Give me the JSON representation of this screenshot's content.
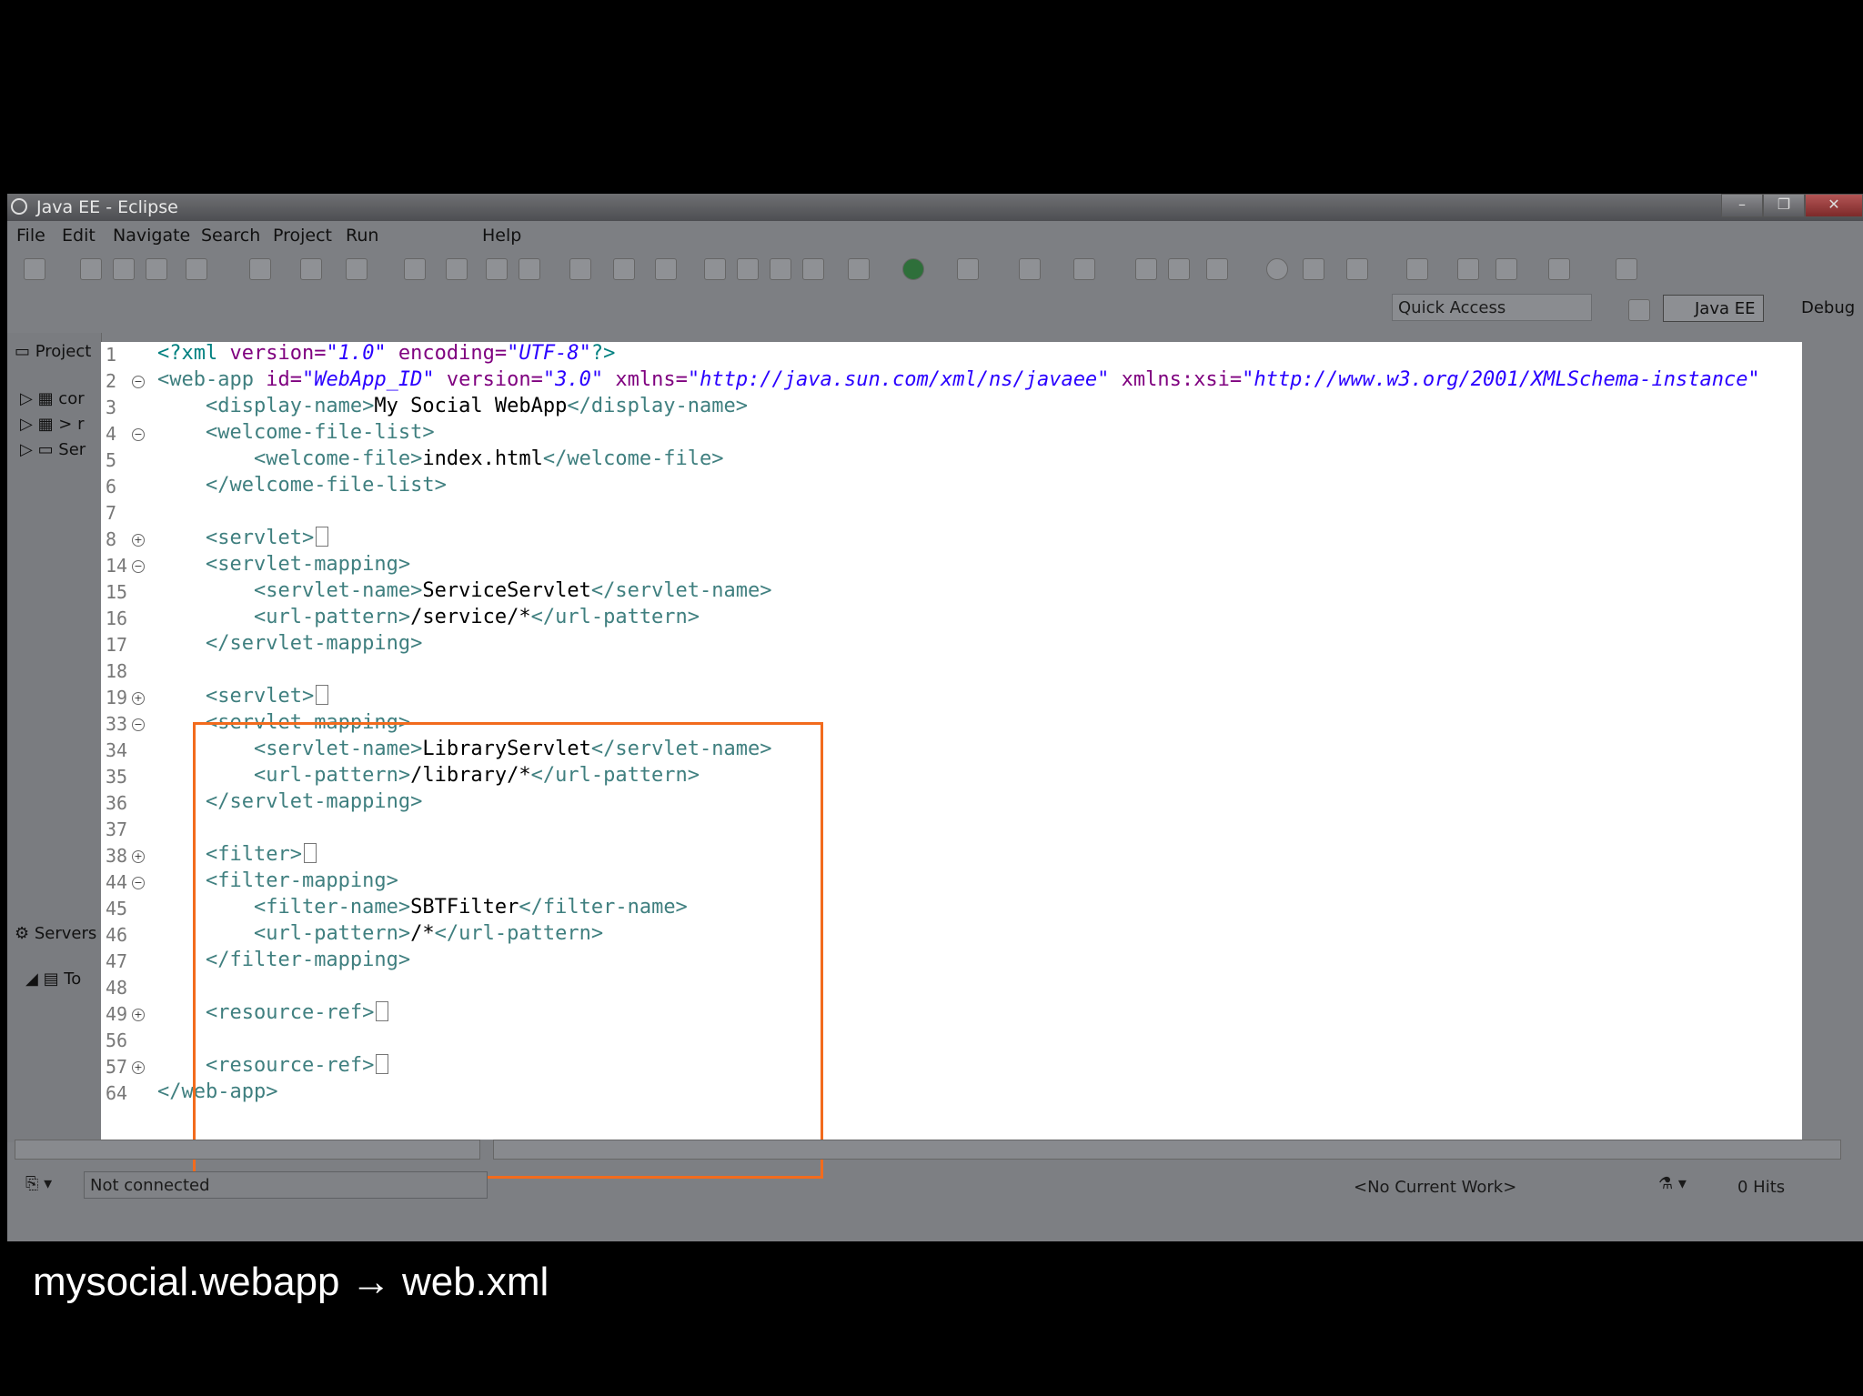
{
  "window": {
    "title": "Java EE - Eclipse"
  },
  "menu": [
    "File",
    "Edit",
    "Navigate",
    "Search",
    "Project",
    "Run",
    "Help"
  ],
  "toolbar": {
    "quick_access_placeholder": "Quick Access"
  },
  "perspectives": {
    "java_ee": "Java EE",
    "debug": "Debug"
  },
  "left_pane": {
    "tab_label": "Project",
    "items": [
      "cor",
      "> r",
      "Ser"
    ]
  },
  "servers_pane": {
    "tab_label": "Servers",
    "items": [
      "To"
    ]
  },
  "editor": {
    "lines": [
      {
        "n": "1",
        "fold": ""
      },
      {
        "n": "2",
        "fold": "minus"
      },
      {
        "n": "3",
        "fold": ""
      },
      {
        "n": "4",
        "fold": "minus"
      },
      {
        "n": "5",
        "fold": ""
      },
      {
        "n": "6",
        "fold": ""
      },
      {
        "n": "7",
        "fold": ""
      },
      {
        "n": "8",
        "fold": "plus"
      },
      {
        "n": "14",
        "fold": "minus"
      },
      {
        "n": "15",
        "fold": ""
      },
      {
        "n": "16",
        "fold": ""
      },
      {
        "n": "17",
        "fold": ""
      },
      {
        "n": "18",
        "fold": ""
      },
      {
        "n": "19",
        "fold": "plus"
      },
      {
        "n": "33",
        "fold": "minus"
      },
      {
        "n": "34",
        "fold": ""
      },
      {
        "n": "35",
        "fold": ""
      },
      {
        "n": "36",
        "fold": ""
      },
      {
        "n": "37",
        "fold": ""
      },
      {
        "n": "38",
        "fold": "plus"
      },
      {
        "n": "44",
        "fold": "minus"
      },
      {
        "n": "45",
        "fold": ""
      },
      {
        "n": "46",
        "fold": ""
      },
      {
        "n": "47",
        "fold": ""
      },
      {
        "n": "48",
        "fold": ""
      },
      {
        "n": "49",
        "fold": "plus"
      },
      {
        "n": "56",
        "fold": ""
      },
      {
        "n": "57",
        "fold": "plus"
      },
      {
        "n": "64",
        "fold": ""
      }
    ],
    "code": {
      "l1_pi_open": "<?xml ",
      "l1_attr1": "version=",
      "l1_val1": "\"1.0\"",
      "l1_attr2": " encoding=",
      "l1_val2": "\"UTF-8\"",
      "l1_pi_close": "?>",
      "l2_tag": "<web-app ",
      "l2_a1": "id=",
      "l2_v1": "\"WebApp_ID\"",
      "l2_a2": " version=",
      "l2_v2": "\"3.0\"",
      "l2_a3": " xmlns=",
      "l2_v3": "\"http://java.sun.com/xml/ns/javaee\"",
      "l2_a4": " xmlns:xsi=",
      "l2_v4": "\"http://www.w3.org/2001/XMLSchema-instance\"",
      "dn_open": "<display-name>",
      "dn_text": "My Social WebApp",
      "dn_close": "</display-name>",
      "wfl_open": "<welcome-file-list>",
      "wf_open": "<welcome-file>",
      "wf_text": "index.html",
      "wf_close": "</welcome-file>",
      "wfl_close": "</welcome-file-list>",
      "servlet_open": "<servlet>",
      "sm_open": "<servlet-mapping>",
      "sn_open": "<servlet-name>",
      "sn_close": "</servlet-name>",
      "up_open": "<url-pattern>",
      "up_close": "</url-pattern>",
      "sm_close": "</servlet-mapping>",
      "sn1": "ServiceServlet",
      "up1": "/service/*",
      "sn2": "LibraryServlet",
      "up2": "/library/*",
      "filter_open": "<filter>",
      "fm_open": "<filter-mapping>",
      "fn_open": "<filter-name>",
      "fn_text": "SBTFilter",
      "fn_close": "</filter-name>",
      "up3": "/*",
      "fm_close": "</filter-mapping>",
      "rr_open": "<resource-ref>",
      "wa_close": "</web-app>"
    }
  },
  "status": {
    "connection": "Not connected",
    "work": "<No Current Work>",
    "hits": "0 Hits"
  },
  "caption": "mysocial.webapp → web.xml",
  "colors": {
    "highlight_box": "#f26b1d",
    "tag": "#3f7f7f",
    "attr": "#7f007f",
    "value": "#2a00ff"
  }
}
